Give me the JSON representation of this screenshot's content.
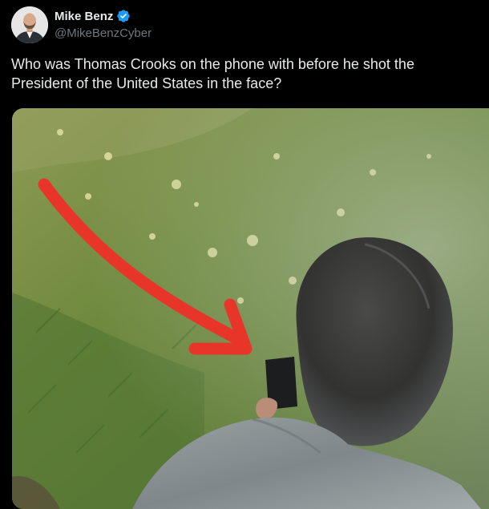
{
  "tweet": {
    "author": {
      "display_name": "Mike Benz",
      "handle": "@MikeBenzCyber",
      "verified": true
    },
    "text": "Who was Thomas Crooks on the phone with before he shot the President of the United States in the face?",
    "media": {
      "type": "photo",
      "annotation": "red-arrow"
    }
  },
  "colors": {
    "background": "#000000",
    "text_primary": "#e7e9ea",
    "text_secondary": "#71767b",
    "verified_badge": "#1d9bf0",
    "arrow": "#e8352a"
  },
  "icons": {
    "verified": "verified-badge-icon"
  }
}
